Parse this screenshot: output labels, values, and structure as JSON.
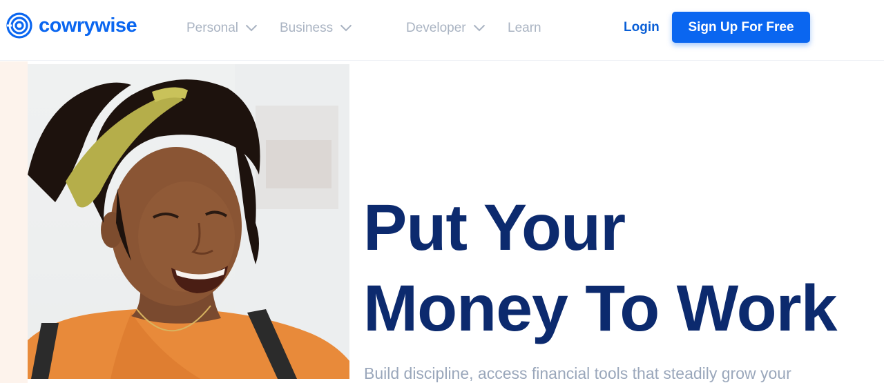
{
  "header": {
    "brand_name": "cowrywise",
    "nav": [
      {
        "label": "Personal",
        "has_dropdown": true
      },
      {
        "label": "Business",
        "has_dropdown": true
      },
      {
        "label": "Developer",
        "has_dropdown": true
      },
      {
        "label": "Learn",
        "has_dropdown": false
      }
    ],
    "login_label": "Login",
    "signup_label": "Sign Up For Free"
  },
  "hero": {
    "headline_line1": "Put Your",
    "headline_line2": "Money To Work",
    "subtitle": "Build discipline, access financial tools that steadily grow your"
  },
  "colors": {
    "brand_blue": "#0a66f0",
    "headline_navy": "#0c2a6e",
    "nav_gray": "#a9b3c2",
    "subtitle_gray": "#9aa7bb"
  },
  "icons": {
    "logo": "cowrywise-spiral-logo-icon",
    "dropdown": "chevron-down-icon"
  }
}
